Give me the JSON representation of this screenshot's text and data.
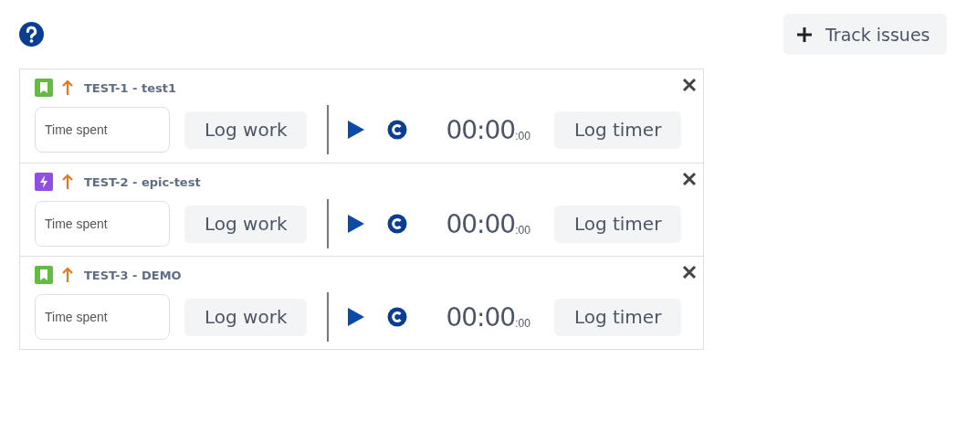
{
  "track_button": {
    "label": "Track issues"
  },
  "issues": [
    {
      "kind": "story",
      "key_title": "TEST-1 - test1",
      "time_placeholder": "Time spent",
      "log_work": "Log work",
      "timer": "00:00",
      "timer_small": ":00",
      "log_timer": "Log timer"
    },
    {
      "kind": "epic",
      "key_title": "TEST-2 - epic-test",
      "time_placeholder": "Time spent",
      "log_work": "Log work",
      "timer": "00:00",
      "timer_small": ":00",
      "log_timer": "Log timer"
    },
    {
      "kind": "story",
      "key_title": "TEST-3 - DEMO",
      "time_placeholder": "Time spent",
      "log_work": "Log work",
      "timer": "00:00",
      "timer_small": ":00",
      "log_timer": "Log timer"
    }
  ]
}
